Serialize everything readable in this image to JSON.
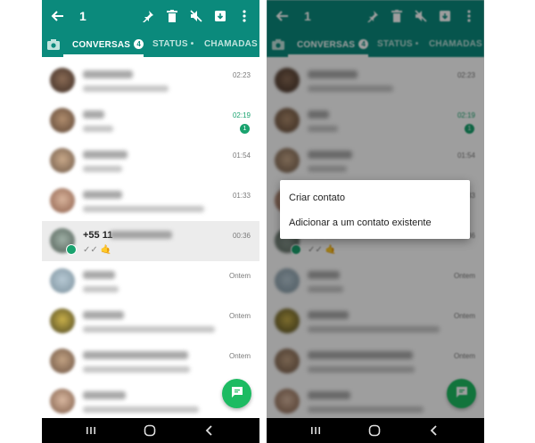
{
  "appbar": {
    "selected_count": "1"
  },
  "tabs": {
    "conversas": "CONVERSAS",
    "conversas_badge": "4",
    "status": "STATUS",
    "status_dot": "•",
    "chamadas": "CHAMADAS"
  },
  "chats": [
    {
      "time": "02:23"
    },
    {
      "time": "02:19",
      "unread": "1"
    },
    {
      "time": "01:54"
    },
    {
      "time": "01:33"
    },
    {
      "name_prefix": "+55 11",
      "time": "00:36",
      "message": "✓✓ 🤙"
    },
    {
      "time": "Ontem"
    },
    {
      "time": "Ontem"
    },
    {
      "time": "Ontem"
    },
    {
      "time": ""
    }
  ],
  "dialog": {
    "option_create": "Criar contato",
    "option_add": "Adicionar a um contato existente"
  },
  "colors": {
    "header": "#0b8a7c",
    "accent": "#1aa36f",
    "fab": "#1dbb62"
  },
  "icons": [
    "back-arrow-icon",
    "pin-icon",
    "delete-icon",
    "mute-icon",
    "archive-icon",
    "more-vert-icon",
    "camera-icon",
    "new-chat-icon",
    "recents-icon",
    "home-icon",
    "nav-back-icon"
  ]
}
